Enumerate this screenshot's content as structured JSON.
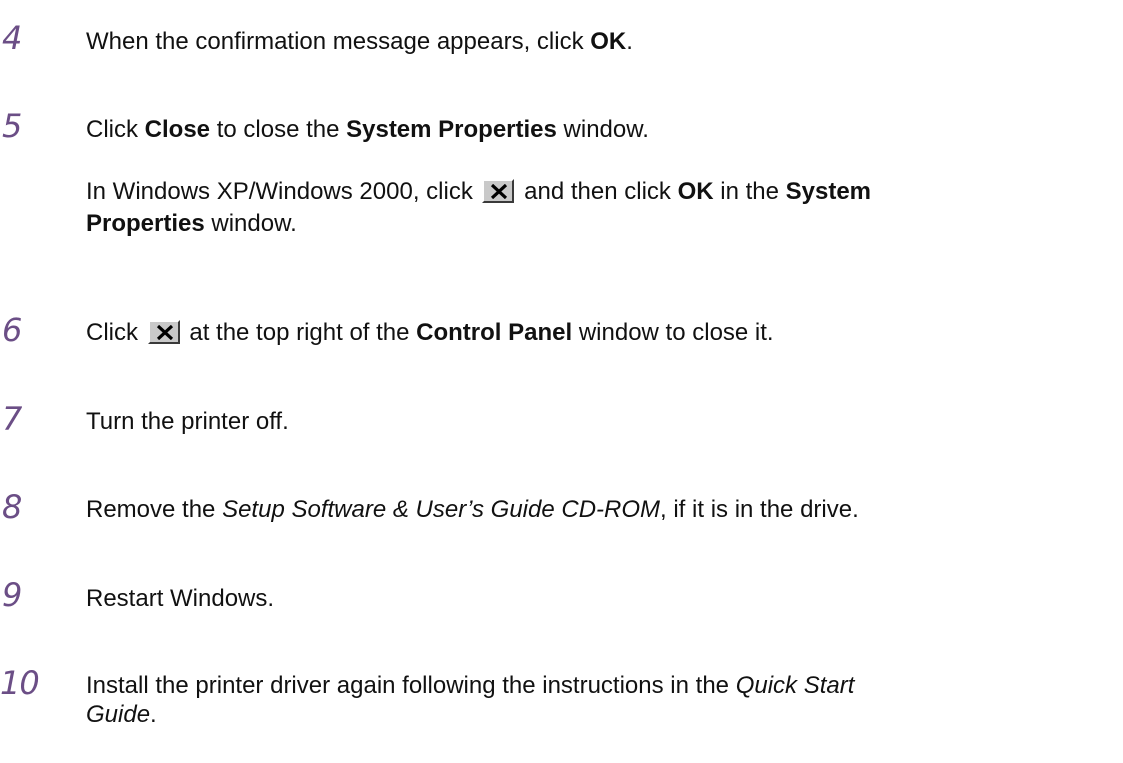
{
  "steps": [
    {
      "number": "4",
      "t1": "When the confirmation message appears, click ",
      "b1": "OK",
      "t2": "."
    },
    {
      "number": "5",
      "t1": "Click ",
      "b1": "Close",
      "t2": " to close the ",
      "b2": "System Properties",
      "t3": " window.",
      "note": {
        "t1": "In Windows XP/Windows 2000, click ",
        "icon": "close-x-icon",
        "t2": " and then click ",
        "b1": "OK",
        "t3": " in the ",
        "b2": "System",
        "b3": "Properties",
        "t4": " window."
      }
    },
    {
      "number": "6",
      "t1": "Click ",
      "icon": "close-x-icon",
      "t2": " at the top right of the ",
      "b1": "Control Panel",
      "t3": " window to close it."
    },
    {
      "number": "7",
      "t1": "Turn the printer off."
    },
    {
      "number": "8",
      "t1": "Remove the ",
      "i1": "Setup Software & User’s Guide CD-ROM",
      "t2": ", if it is in the drive."
    },
    {
      "number": "9",
      "t1": "Restart Windows."
    },
    {
      "number": "10",
      "t1": "Install the printer driver again following the instructions in the ",
      "i1": "Quick Start",
      "i2": "Guide",
      "t2": "."
    }
  ],
  "colors": {
    "step_number": "#6b4e86",
    "text": "#111111"
  }
}
